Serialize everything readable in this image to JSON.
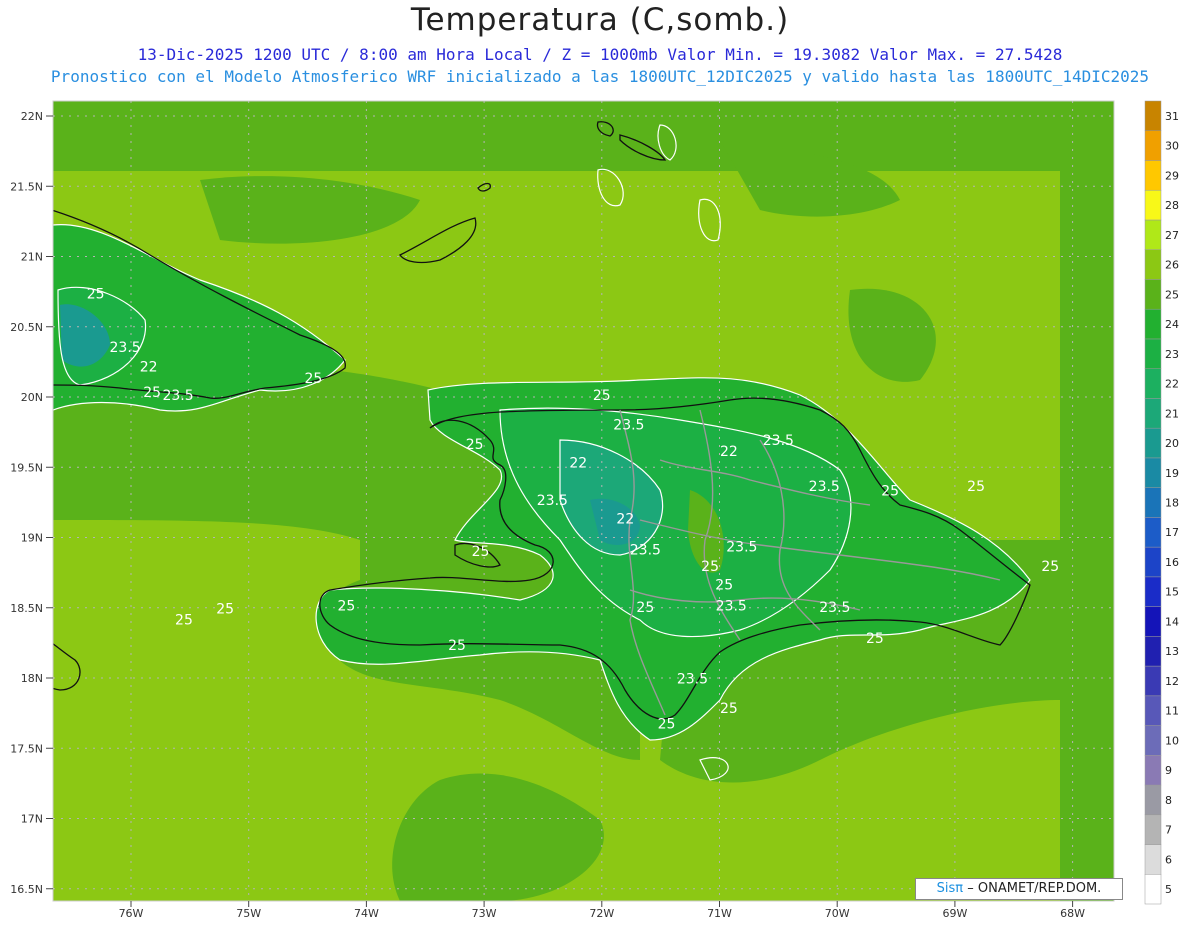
{
  "header": {
    "title": "Temperatura (C,somb.)",
    "line1": "13-Dic-2025  1200 UTC / 8:00 am Hora Local / Z = 1000mb   Valor Min. = 19.3082  Valor Max. = 27.5428",
    "line2": "Pronostico con el Modelo Atmosferico WRF inicializado a las 1800UTC_12DIC2025 y valido hasta las  1800UTC_14DIC2025"
  },
  "lat_labels": [
    "22N",
    "21.5N",
    "21N",
    "20.5N",
    "20N",
    "19.5N",
    "19N",
    "18.5N",
    "18N",
    "17.5N",
    "17N",
    "16.5N"
  ],
  "lat_values": [
    22,
    21.5,
    21,
    20.5,
    20,
    19.5,
    19,
    18.5,
    18,
    17.5,
    17,
    16.5
  ],
  "lon_labels": [
    "76W",
    "75W",
    "74W",
    "73W",
    "72W",
    "71W",
    "70W",
    "69W",
    "68W"
  ],
  "lon_values": [
    -76,
    -75,
    -74,
    -73,
    -72,
    -71,
    -70,
    -69,
    -68
  ],
  "colorbar": {
    "levels": [
      5,
      6,
      7,
      8,
      9,
      10,
      11,
      12,
      13,
      14,
      15,
      16,
      17,
      18,
      19,
      20,
      21,
      22,
      23,
      24,
      25,
      26,
      27,
      28,
      29,
      30,
      31
    ],
    "colors": [
      "#ffffff",
      "#dcdcdc",
      "#b4b4b4",
      "#9a9aa4",
      "#8a7ab4",
      "#6c6cb8",
      "#5858b8",
      "#3a3ab4",
      "#2020b0",
      "#1414b8",
      "#1a2cc8",
      "#1c44c8",
      "#1c5cc8",
      "#1a74b8",
      "#1a8aa4",
      "#1a9a90",
      "#1ca878",
      "#1cb060",
      "#1cb044",
      "#22b030",
      "#5ab21a",
      "#8cc814",
      "#b0e818",
      "#f8f818",
      "#ffc800",
      "#f0a000",
      "#c88400"
    ]
  },
  "contour_labels": [
    {
      "text": "25",
      "lon": -76.3,
      "lat": 20.7
    },
    {
      "text": "23.5",
      "lon": -76.05,
      "lat": 20.32
    },
    {
      "text": "22",
      "lon": -75.85,
      "lat": 20.18
    },
    {
      "text": "25",
      "lon": -75.82,
      "lat": 20.0
    },
    {
      "text": "23.5",
      "lon": -75.6,
      "lat": 19.98
    },
    {
      "text": "25",
      "lon": -74.45,
      "lat": 20.1
    },
    {
      "text": "25",
      "lon": -72.0,
      "lat": 19.98
    },
    {
      "text": "25",
      "lon": -73.08,
      "lat": 19.63
    },
    {
      "text": "23.5",
      "lon": -71.77,
      "lat": 19.77
    },
    {
      "text": "22",
      "lon": -72.2,
      "lat": 19.5
    },
    {
      "text": "22",
      "lon": -70.92,
      "lat": 19.58
    },
    {
      "text": "23.5",
      "lon": -70.5,
      "lat": 19.66
    },
    {
      "text": "23.5",
      "lon": -72.42,
      "lat": 19.23
    },
    {
      "text": "23.5",
      "lon": -70.11,
      "lat": 19.33
    },
    {
      "text": "25",
      "lon": -69.55,
      "lat": 19.3
    },
    {
      "text": "25",
      "lon": -68.82,
      "lat": 19.33
    },
    {
      "text": "22",
      "lon": -71.8,
      "lat": 19.1
    },
    {
      "text": "25",
      "lon": -73.03,
      "lat": 18.87
    },
    {
      "text": "23.5",
      "lon": -71.63,
      "lat": 18.88
    },
    {
      "text": "23.5",
      "lon": -70.81,
      "lat": 18.9
    },
    {
      "text": "25",
      "lon": -71.08,
      "lat": 18.76
    },
    {
      "text": "25",
      "lon": -70.96,
      "lat": 18.63
    },
    {
      "text": "25",
      "lon": -68.19,
      "lat": 18.76
    },
    {
      "text": "25",
      "lon": -74.17,
      "lat": 18.48
    },
    {
      "text": "25",
      "lon": -75.2,
      "lat": 18.46
    },
    {
      "text": "25",
      "lon": -75.55,
      "lat": 18.38
    },
    {
      "text": "25",
      "lon": -71.63,
      "lat": 18.47
    },
    {
      "text": "23.5",
      "lon": -70.9,
      "lat": 18.48
    },
    {
      "text": "23.5",
      "lon": -70.02,
      "lat": 18.47
    },
    {
      "text": "25",
      "lon": -73.23,
      "lat": 18.2
    },
    {
      "text": "25",
      "lon": -69.68,
      "lat": 18.25
    },
    {
      "text": "23.5",
      "lon": -71.23,
      "lat": 17.96
    },
    {
      "text": "25",
      "lon": -70.92,
      "lat": 17.75
    },
    {
      "text": "25",
      "lon": -71.45,
      "lat": 17.64
    }
  ],
  "credit": {
    "sis": "Sisπ",
    "rest": "– ONAMET/REP.DOM."
  }
}
